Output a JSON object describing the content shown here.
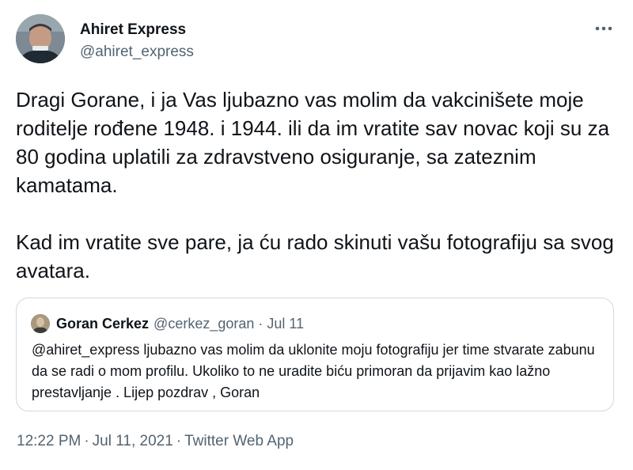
{
  "author": {
    "display_name": "Ahiret Express",
    "handle": "@ahiret_express"
  },
  "tweet": {
    "paragraphs": [
      "Dragi Gorane, i ja Vas ljubazno vas molim da vakcinišete moje roditelje rođene 1948. i 1944. ili da im vratite sav novac koji su za 80 godina uplatili za zdravstveno osiguranje, sa zateznim kamatama.",
      "Kad im vratite sve pare, ja ću rado skinuti vašu fotografiju sa svog avatara."
    ]
  },
  "quoted_tweet": {
    "display_name": "Goran Cerkez",
    "handle": "@cerkez_goran",
    "separator": "·",
    "date": "Jul 11",
    "text": "@ahiret_express ljubazno vas molim da uklonite moju fotografiju jer time stvarate zabunu da se radi o mom profilu. Ukoliko to ne uradite biću primoran da prijavim kao lažno prestavljanje . Lijep pozdrav , Goran"
  },
  "meta": {
    "time": "12:22 PM",
    "separator": "·",
    "date": "Jul 11, 2021",
    "source": "Twitter Web App"
  },
  "icons": {
    "more": "more-horizontal-icon"
  },
  "colors": {
    "text_primary": "#0f1419",
    "text_secondary": "#536471",
    "border": "#cfd9de"
  }
}
